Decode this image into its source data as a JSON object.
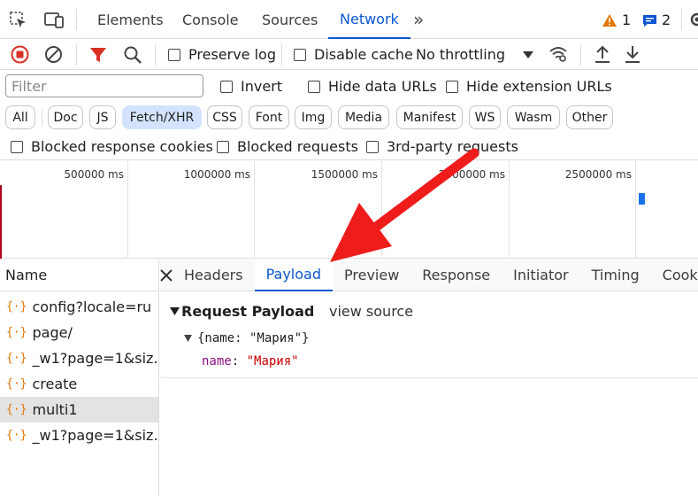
{
  "topbar": {
    "tabs": [
      {
        "label": "Elements"
      },
      {
        "label": "Console"
      },
      {
        "label": "Sources"
      },
      {
        "label": "Network"
      }
    ],
    "more": "»",
    "warnings": "1",
    "messages": "2"
  },
  "toolbar": {
    "preserve_log": "Preserve log",
    "disable_cache": "Disable cache",
    "throttling": "No throttling"
  },
  "filters": {
    "placeholder": "Filter",
    "invert": "Invert",
    "hide_data_urls": "Hide data URLs",
    "hide_ext_urls": "Hide extension URLs",
    "types": [
      "All",
      "Doc",
      "JS",
      "Fetch/XHR",
      "CSS",
      "Font",
      "Img",
      "Media",
      "Manifest",
      "WS",
      "Wasm",
      "Other"
    ],
    "blocked_cookies": "Blocked response cookies",
    "blocked_requests": "Blocked requests",
    "third_party": "3rd-party requests"
  },
  "overview": {
    "ticks": [
      "500000 ms",
      "1000000 ms",
      "1500000 ms",
      "2000000 ms",
      "2500000 ms"
    ]
  },
  "requests": {
    "header": "Name",
    "items": [
      {
        "name": "config?locale=ru"
      },
      {
        "name": "page/"
      },
      {
        "name": "_w1?page=1&siz..."
      },
      {
        "name": "create"
      },
      {
        "name": "multi1"
      },
      {
        "name": "_w1?page=1&siz..."
      }
    ]
  },
  "detail": {
    "tabs": [
      "Headers",
      "Payload",
      "Preview",
      "Response",
      "Initiator",
      "Timing",
      "Cookie"
    ],
    "section_title": "Request Payload",
    "view_source": "view source",
    "payload_summary": "{name: \"Мария\"}",
    "key": "name",
    "colon": ":",
    "value": "\"Мария\""
  },
  "colors": {
    "accent": "#0b57d0",
    "record_red": "#d93025",
    "arrow_red": "#ef1c1c",
    "key_purple": "#881280",
    "string_red": "#c80000"
  }
}
